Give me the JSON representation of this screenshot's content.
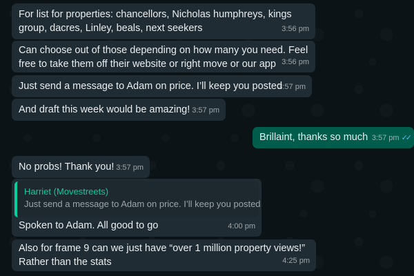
{
  "messages": [
    {
      "text_line1": "For list for properties: chancellors, Nicholas humphreys, kings",
      "text_line2": "group, dacres, Linley, beals, next seekers",
      "time": "3:56 pm"
    },
    {
      "text_line1": "Can choose out of those depending on how many you need. Feel",
      "text_line2": "free to take them off their website or right move or our app",
      "time": "3:56 pm"
    },
    {
      "text": "Just send a message to Adam on price. I’ll keep you posted",
      "time": "3:57 pm"
    },
    {
      "text": "And draft this week would be amazing!",
      "time": "3:57 pm"
    },
    {
      "text": "Brillaint, thanks so much",
      "time": "3:57 pm",
      "status": "read"
    },
    {
      "text": "No probs! Thank you!",
      "time": "3:57 pm"
    },
    {
      "quote_author": "Harriet (Movestreets)",
      "quote_text": "Just send a message to Adam on price. I’ll keep you posted",
      "text": "Spoken to Adam. All good to go",
      "time": "4:00 pm"
    },
    {
      "text_line1": "Also for frame 9 can we just have “over 1 million property views!”",
      "text_line2": "Rather than the stats",
      "time": "4:25 pm"
    }
  ],
  "icons": {
    "read_receipt": "double-check-icon"
  },
  "colors": {
    "incoming_bubble": "#202c33",
    "outgoing_bubble": "#005c4b",
    "quote_accent": "#06cf9c",
    "read_tick": "#53bdeb"
  }
}
